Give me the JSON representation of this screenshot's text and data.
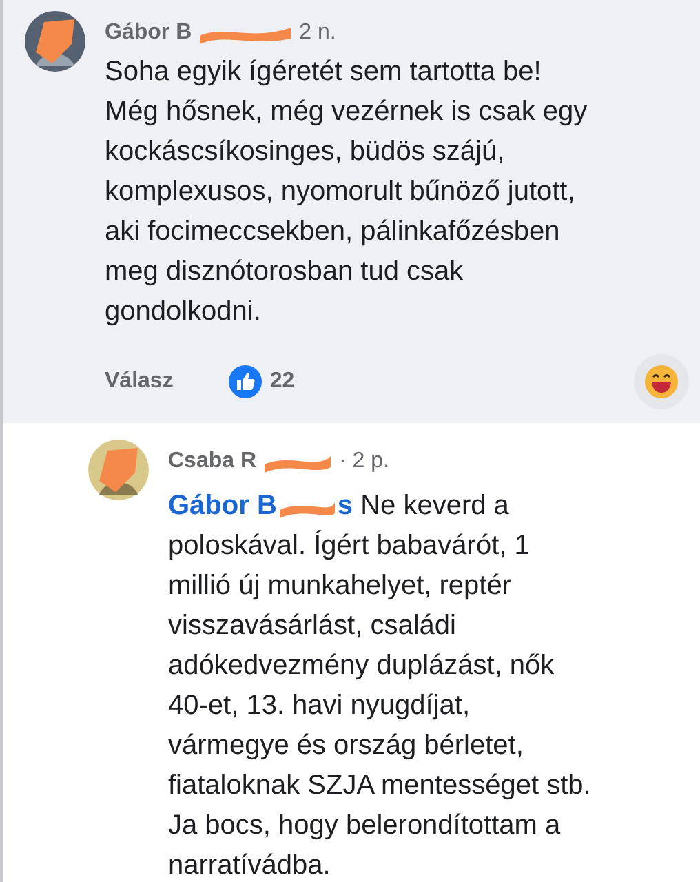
{
  "comments": [
    {
      "kind": "comment",
      "author": "Gábor B",
      "time": "2 n.",
      "body_lines": [
        "Soha egyik ígéretét sem tartotta be!",
        "Még hősnek, még vezérnek is csak egy",
        "kockáscsíkosinges, büdös szájú,",
        "komplexusos, nyomorult bűnöző jutott,",
        "aki focimeccsekben, pálinkafőzésben",
        "meg disznótorosban tud csak",
        "gondolkodni."
      ],
      "reply_label": "Válasz",
      "like_count": "22"
    },
    {
      "kind": "reply",
      "author": "Csaba R",
      "time": "· 2 p.",
      "mention": {
        "start": "Gábor B",
        "end": "s"
      },
      "body_lines": [
        "Ne keverd a",
        "poloskával. Ígért babavárót, 1",
        "millió új munkahelyet, reptér",
        "visszavásárlást, családi",
        "adókedvezmény duplázást, nők",
        "40-et, 13. havi nyugdíjat,",
        "vármegye és ország bérletet,",
        "fiataloknak SZJA mentességet stb.",
        "Ja bocs, hogy belerondítottam a",
        "narratívádba."
      ]
    }
  ]
}
